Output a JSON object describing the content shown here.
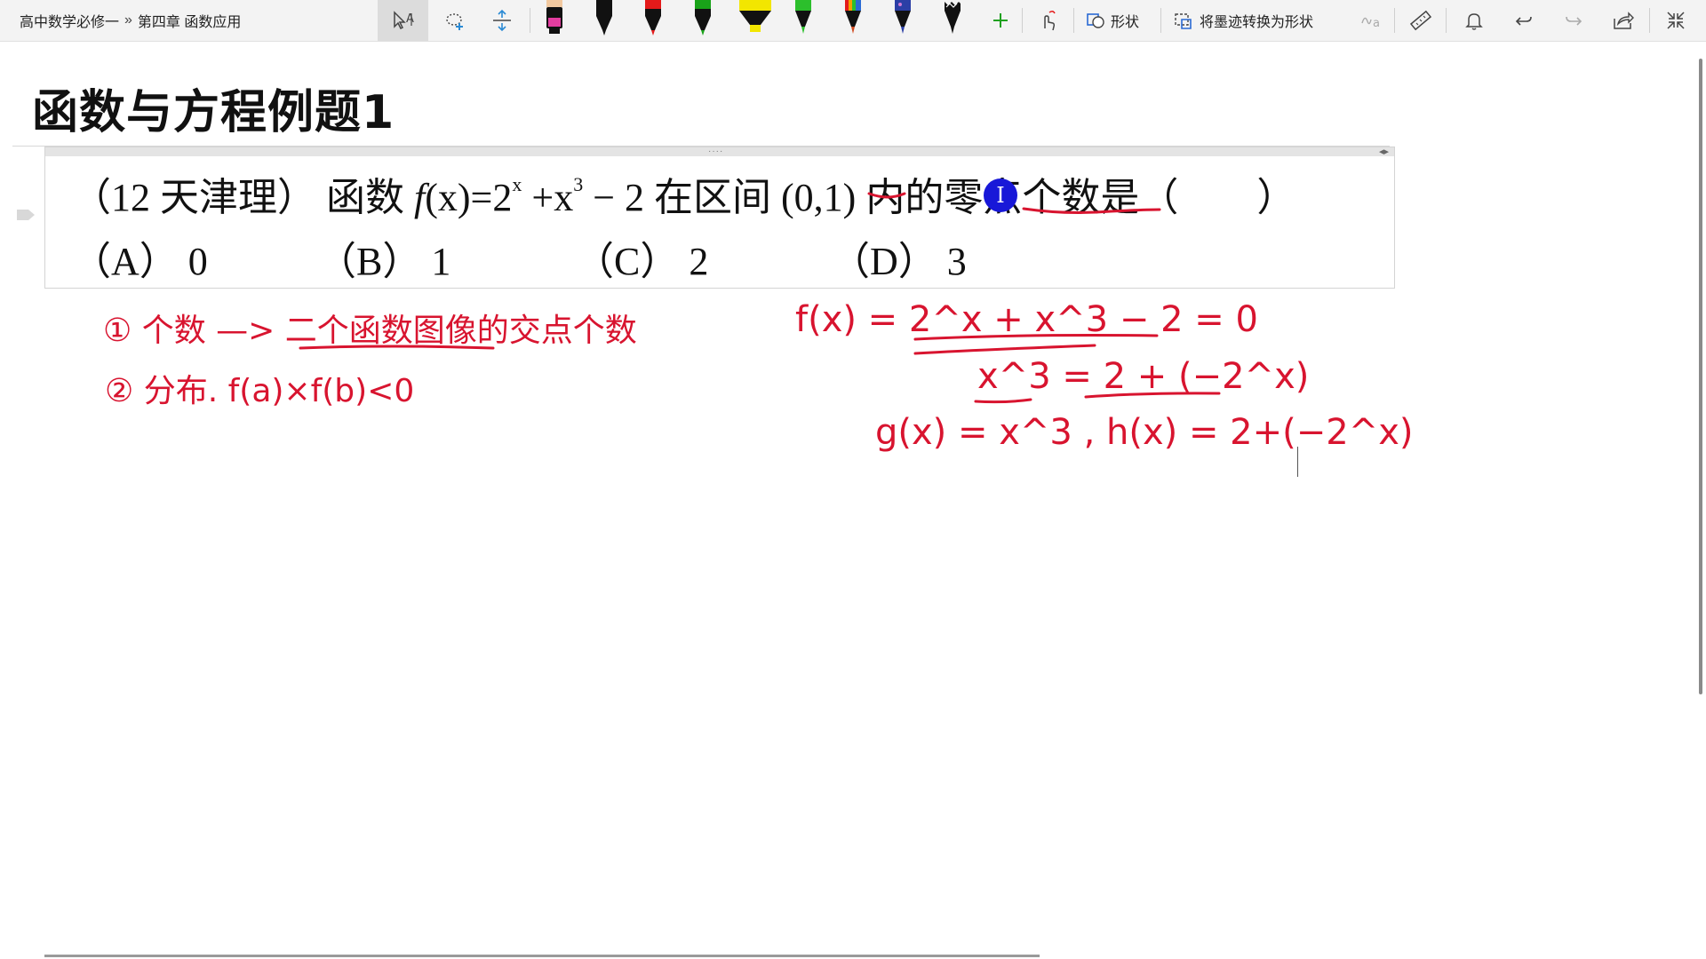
{
  "breadcrumb": {
    "notebook": "高中数学必修一",
    "separator": "»",
    "section": "第四章 函数应用"
  },
  "toolbar": {
    "shape_label": "形状",
    "ink_to_shape_label": "将墨迹转换为形状",
    "pens": [
      {
        "name": "pen-black-pink",
        "color": "#111111"
      },
      {
        "name": "pen-black",
        "color": "#111111"
      },
      {
        "name": "pen-red",
        "color": "#e41a1a"
      },
      {
        "name": "pen-green",
        "color": "#19a319"
      },
      {
        "name": "highlighter-yellow",
        "color": "#f2e600"
      },
      {
        "name": "pen-green-2",
        "color": "#2cbf2c"
      },
      {
        "name": "pen-rainbow",
        "color": "#d14a1f"
      },
      {
        "name": "pen-galaxy",
        "color": "#2b3fa6"
      },
      {
        "name": "pen-black-zigzag",
        "color": "#111111"
      }
    ]
  },
  "page": {
    "title": "函数与方程例题1",
    "question": {
      "source": "（12 天津理）",
      "stem_pre": "函数",
      "fx": "f",
      "paren_x": "(x)",
      "eq": "=2",
      "sup_x": "x",
      "plus": " +x",
      "sup_3": "3",
      "minus": " − 2 ",
      "interval_text": "在区间",
      "interval": "(0,1)",
      "stem_post": "内的零点个数是（　　）"
    },
    "options": [
      {
        "letter": "（A）",
        "value": "0"
      },
      {
        "letter": "（B）",
        "value": "1"
      },
      {
        "letter": "（C）",
        "value": "2"
      },
      {
        "letter": "（D）",
        "value": "3"
      }
    ]
  },
  "handwriting": {
    "color": "#d8142f",
    "lines": [
      "① 个数 —> 二个函数图像的交点个数",
      "② 分布.  f(a)×f(b)<0",
      "f(x) = 2^x + x^3 − 2 = 0",
      "x^3 = 2 + (−2^x)",
      "g(x) = x^3 ,  h(x) = 2+(−2^x)"
    ]
  }
}
